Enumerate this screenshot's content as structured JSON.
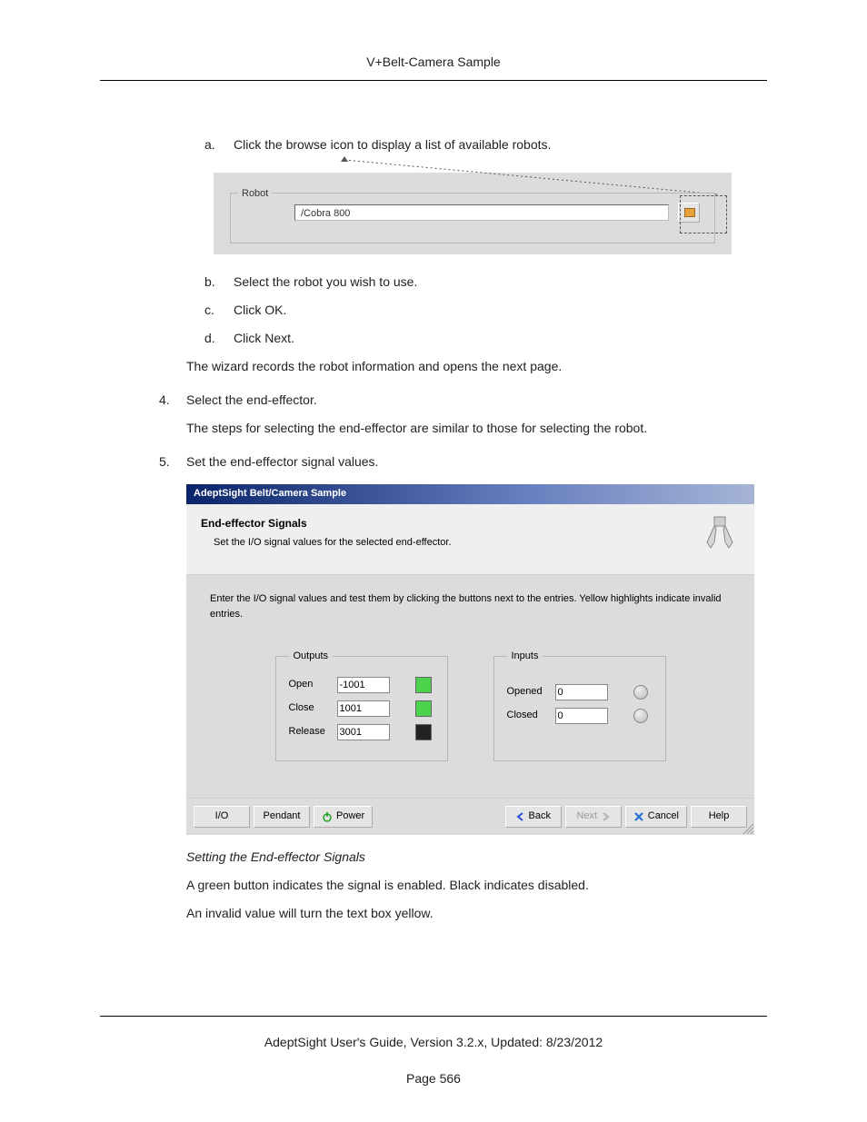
{
  "header": {
    "title": "V+Belt-Camera Sample"
  },
  "subList": {
    "a": {
      "letter": "a.",
      "text": "Click the browse icon to display a list of available robots."
    },
    "b": {
      "letter": "b.",
      "text": "Select the robot you wish to use."
    },
    "c": {
      "letter": "c.",
      "text": "Click OK."
    },
    "d": {
      "letter": "d.",
      "text": "Click Next."
    }
  },
  "fig1": {
    "legend": "Robot",
    "value": "/Cobra 800"
  },
  "paras": {
    "afterSublist": "The wizard records the robot information and opens the next page.",
    "four_num": "4.",
    "four_text": "Select the end-effector.",
    "four_detail": "The steps for selecting the end-effector are similar to those for selecting the robot.",
    "five_num": "5.",
    "five_text": "Set the end-effector signal values.",
    "caption": "Setting the End-effector Signals",
    "green": "A green button indicates the signal is enabled. Black indicates disabled.",
    "yellow": "An invalid value will turn the text box yellow."
  },
  "wizard": {
    "title": "AdeptSight Belt/Camera Sample",
    "head_title": "End-effector Signals",
    "head_sub": "Set the I/O signal values for the selected end-effector.",
    "body_instr": "Enter the I/O signal values and test them by clicking the buttons next to the entries.  Yellow highlights indicate invalid entries.",
    "outputs": {
      "legend": "Outputs",
      "open": {
        "label": "Open",
        "value": "-1001"
      },
      "close": {
        "label": "Close",
        "value": "1001"
      },
      "release": {
        "label": "Release",
        "value": "3001"
      }
    },
    "inputs": {
      "legend": "Inputs",
      "opened": {
        "label": "Opened",
        "value": "0"
      },
      "closed": {
        "label": "Closed",
        "value": "0"
      }
    },
    "buttons": {
      "io": "I/O",
      "pendant": "Pendant",
      "power": "Power",
      "back": "Back",
      "next": "Next",
      "cancel": "Cancel",
      "help": "Help"
    }
  },
  "footer": {
    "line1": "AdeptSight User's Guide,  Version 3.2.x, Updated: 8/23/2012",
    "line2": "Page 566"
  }
}
